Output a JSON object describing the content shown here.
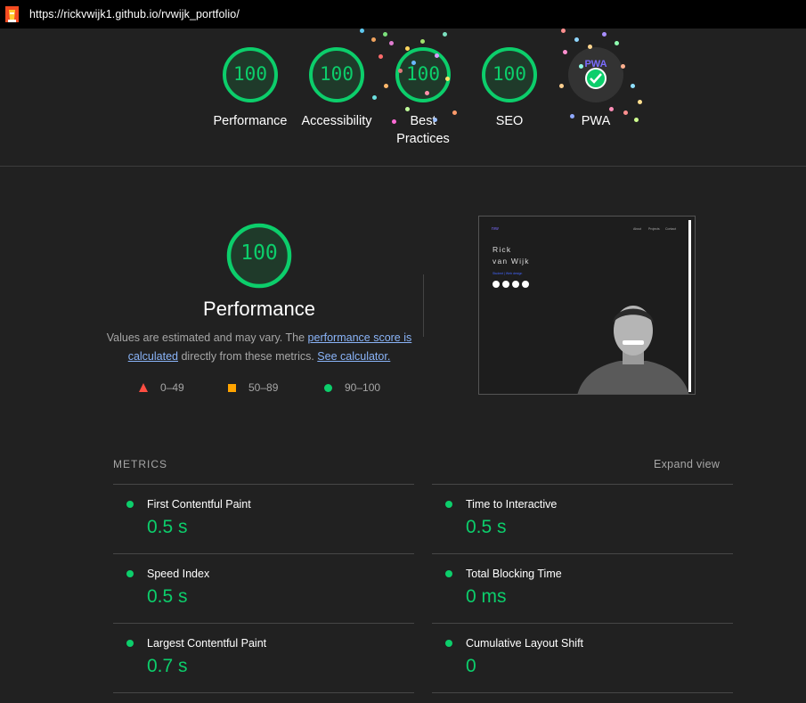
{
  "url_bar": {
    "url": "https://rickvwijk1.github.io/rvwijk_portfolio/"
  },
  "gauges": [
    {
      "score": "100",
      "label": "Performance"
    },
    {
      "score": "100",
      "label": "Accessibility"
    },
    {
      "score": "100",
      "label": "Best Practices"
    },
    {
      "score": "100",
      "label": "SEO"
    }
  ],
  "pwa": {
    "label": "PWA",
    "badge": "PWA"
  },
  "performance": {
    "score": "100",
    "title": "Performance",
    "desc_1": "Values are estimated and may vary. The ",
    "link_score": "performance score is calculated",
    "desc_2": " directly from these metrics. ",
    "link_calc": "See calculator.",
    "legend": {
      "fail": "0–49",
      "average": "50–89",
      "pass": "90–100"
    },
    "colors": {
      "pass": "#0cce6b",
      "average": "#ffa400",
      "fail": "#ff4e42"
    }
  },
  "screenshot": {
    "brand": "rvw",
    "nav": [
      "About",
      "Projects",
      "Contact"
    ],
    "name_line1": "Rick",
    "name_line2": "van Wijk",
    "subtitle": "Student | Web design"
  },
  "metrics": {
    "title": "METRICS",
    "expand": "Expand view",
    "items": [
      {
        "name": "First Contentful Paint",
        "value": "0.5 s"
      },
      {
        "name": "Time to Interactive",
        "value": "0.5 s"
      },
      {
        "name": "Speed Index",
        "value": "0.5 s"
      },
      {
        "name": "Total Blocking Time",
        "value": "0 ms"
      },
      {
        "name": "Largest Contentful Paint",
        "value": "0.7 s"
      },
      {
        "name": "Cumulative Layout Shift",
        "value": "0"
      }
    ]
  }
}
